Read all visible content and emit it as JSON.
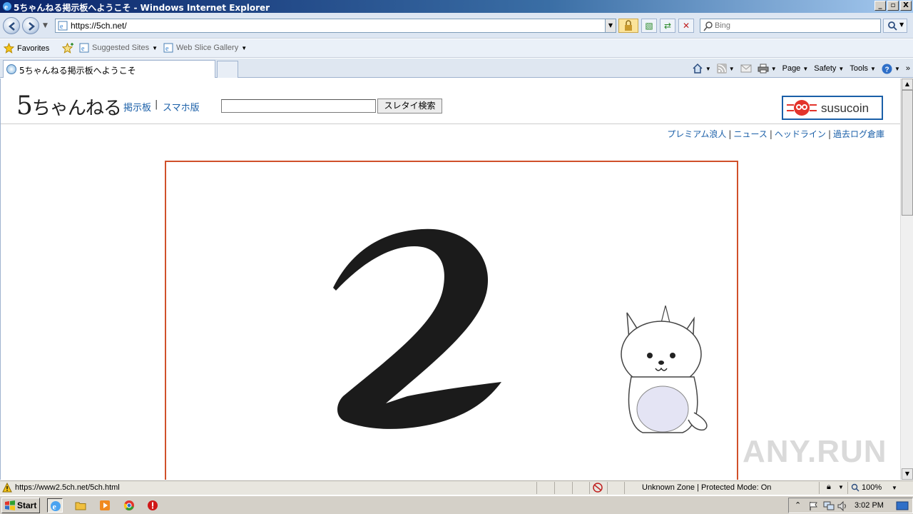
{
  "window": {
    "title": "5ちゃんねる掲示板へようこそ - Windows Internet Explorer",
    "controls": [
      "_",
      "▫",
      "X"
    ]
  },
  "address": {
    "url": "https://5ch.net/",
    "search_placeholder": "Bing"
  },
  "favorites_bar": {
    "favorites_label": "Favorites",
    "suggested_sites": "Suggested Sites",
    "web_slice_gallery": "Web Slice Gallery"
  },
  "tab": {
    "label": "5ちゃんねる掲示板へようこそ"
  },
  "command_bar": {
    "page": "Page",
    "safety": "Safety",
    "tools": "Tools"
  },
  "site": {
    "logo_first": "5",
    "logo_rest": "ちゃんねる",
    "nav_board": "掲示板",
    "nav_separator": "|",
    "nav_smartphone": "スマホ版",
    "search_button": "スレタイ検索",
    "susucoin_label": "susucoin",
    "top_links": [
      "プレミアム浪人",
      "ニュース",
      "ヘッドライン",
      "過去ログ倉庫"
    ]
  },
  "watermark": "ANY.RUN",
  "status": {
    "link_url": "https://www2.5ch.net/5ch.html",
    "zone": "Unknown Zone | Protected Mode: On",
    "zoom": "100%"
  },
  "taskbar": {
    "start": "Start",
    "clock": "3:02 PM"
  },
  "colors": {
    "link": "#1a5fa8",
    "frame_border": "#d0502a",
    "susucoin_border": "#1a5fa8"
  }
}
